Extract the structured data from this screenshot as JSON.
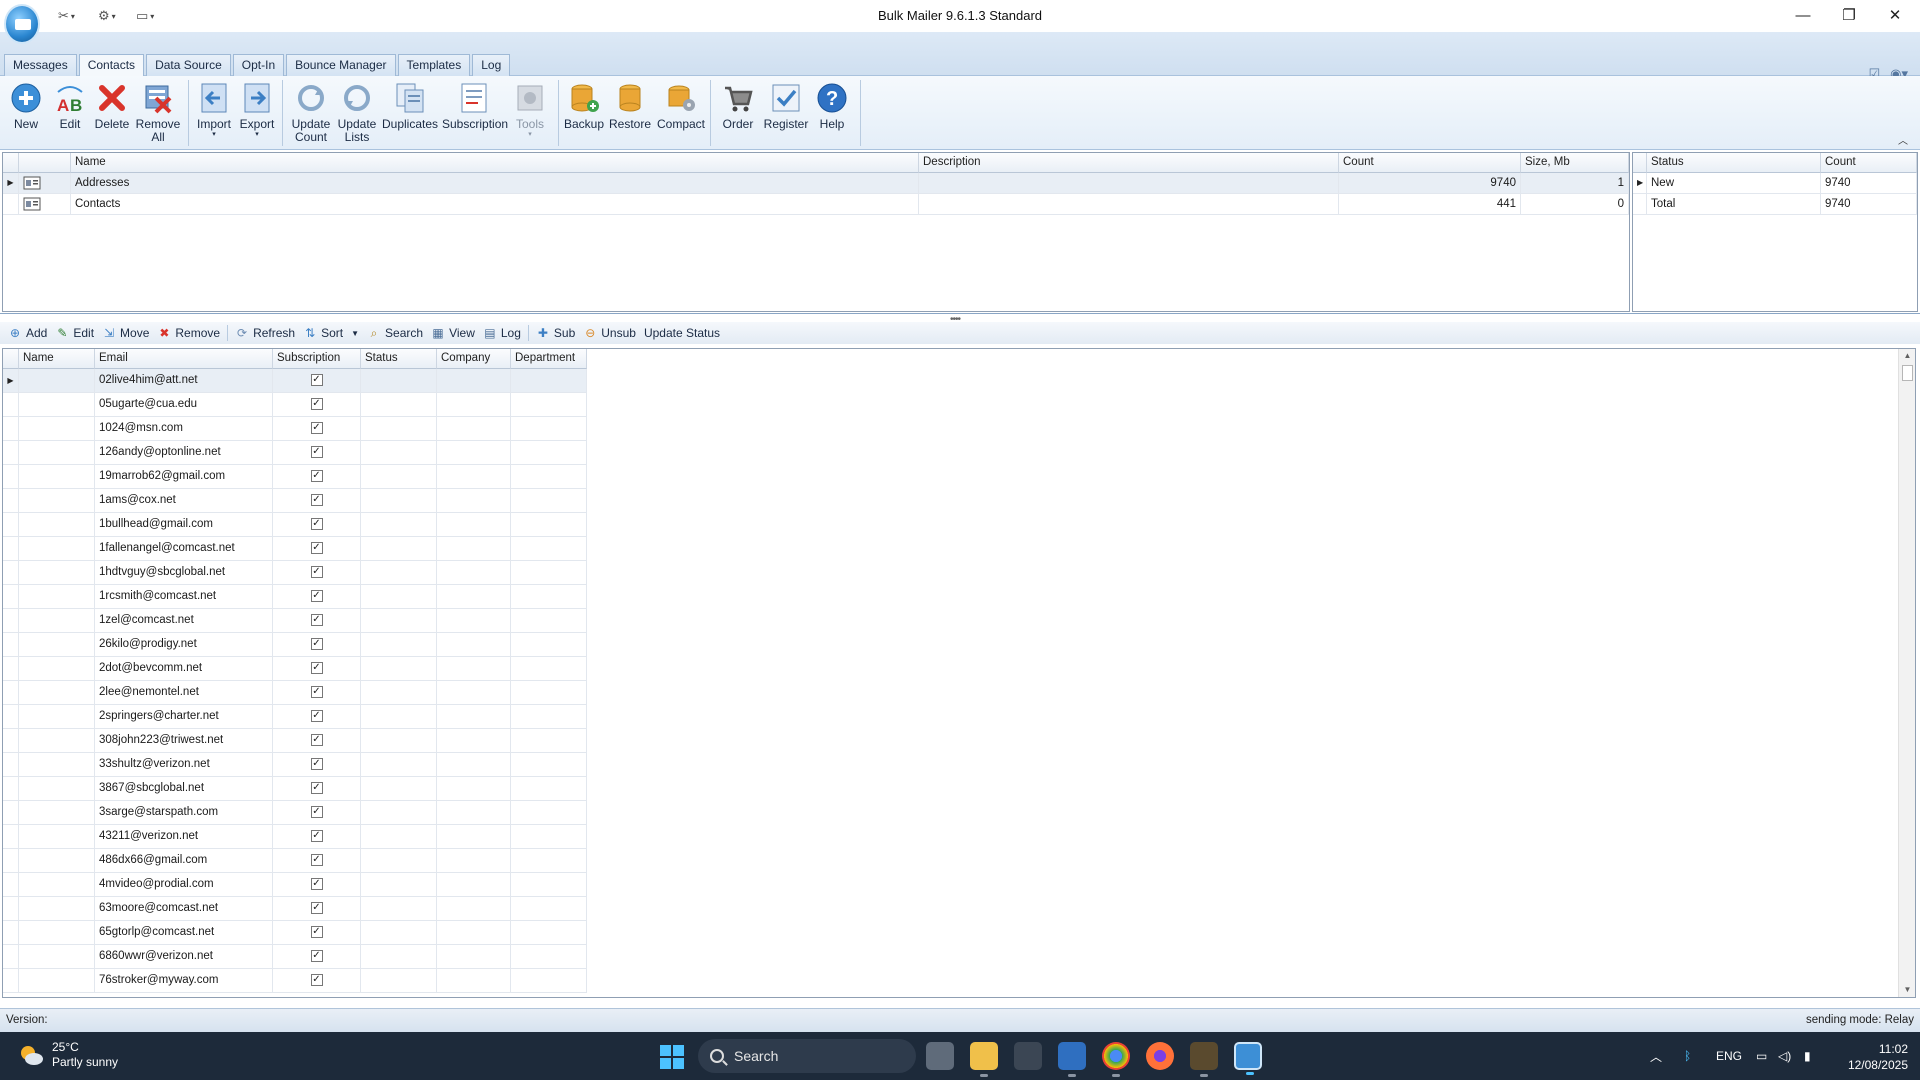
{
  "window": {
    "title": "Bulk Mailer 9.6.1.3 Standard"
  },
  "tabs": [
    {
      "label": "Messages"
    },
    {
      "label": "Contacts",
      "active": true
    },
    {
      "label": "Data Source"
    },
    {
      "label": "Opt-In"
    },
    {
      "label": "Bounce Manager"
    },
    {
      "label": "Templates"
    },
    {
      "label": "Log"
    }
  ],
  "ribbon": {
    "new": "New",
    "edit": "Edit",
    "delete": "Delete",
    "remove_all_1": "Remove",
    "remove_all_2": "All",
    "import": "Import",
    "export": "Export",
    "update_count_1": "Update",
    "update_count_2": "Count",
    "update_lists_1": "Update",
    "update_lists_2": "Lists",
    "duplicates": "Duplicates",
    "subscription": "Subscription",
    "tools": "Tools",
    "backup": "Backup",
    "restore": "Restore",
    "compact": "Compact",
    "order": "Order",
    "register": "Register",
    "help": "Help"
  },
  "lists": {
    "columns": [
      "Name",
      "Description",
      "Count",
      "Size, Mb"
    ],
    "rows": [
      {
        "name": "Addresses",
        "description": "",
        "count": "9740",
        "size": "1"
      },
      {
        "name": "Contacts",
        "description": "",
        "count": "441",
        "size": "0"
      }
    ]
  },
  "status_summary": {
    "columns": [
      "Status",
      "Count"
    ],
    "rows": [
      {
        "status": "New",
        "count": "9740"
      },
      {
        "status": "Total",
        "count": "9740"
      }
    ]
  },
  "toolbar": {
    "add": "Add",
    "edit": "Edit",
    "move": "Move",
    "remove": "Remove",
    "refresh": "Refresh",
    "sort": "Sort",
    "search": "Search",
    "view": "View",
    "log": "Log",
    "sub": "Sub",
    "unsub": "Unsub",
    "update_status": "Update Status"
  },
  "contacts": {
    "columns": [
      "Name",
      "Email",
      "Subscription",
      "Status",
      "Company",
      "Department"
    ],
    "rows": [
      "02live4him@att.net",
      "05ugarte@cua.edu",
      "1024@msn.com",
      "126andy@optonline.net",
      "19marrob62@gmail.com",
      "1ams@cox.net",
      "1bullhead@gmail.com",
      "1fallenangel@comcast.net",
      "1hdtvguy@sbcglobal.net",
      "1rcsmith@comcast.net",
      "1zel@comcast.net",
      "26kilo@prodigy.net",
      "2dot@bevcomm.net",
      "2lee@nemontel.net",
      "2springers@charter.net",
      "308john223@triwest.net",
      "33shultz@verizon.net",
      "3867@sbcglobal.net",
      "3sarge@starspath.com",
      "43211@verizon.net",
      "486dx66@gmail.com",
      "4mvideo@prodial.com",
      "63moore@comcast.net",
      "65gtorlp@comcast.net",
      "6860wwr@verizon.net",
      "76stroker@myway.com"
    ]
  },
  "statusbar": {
    "version": "Version:",
    "mode": "sending mode: Relay"
  },
  "taskbar": {
    "temp": "25°C",
    "weather": "Partly sunny",
    "search": "Search",
    "lang": "ENG",
    "time": "11:02",
    "date": "12/08/2025"
  }
}
